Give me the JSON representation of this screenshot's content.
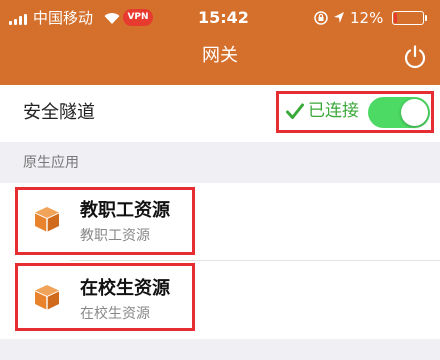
{
  "status_bar": {
    "carrier": "中国移动",
    "vpn_badge": "VPN",
    "time": "15:42",
    "battery_percent": "12%",
    "battery_level": 0.12,
    "icons": [
      "signal-icon",
      "wifi-icon",
      "rotation-lock-icon",
      "location-icon",
      "battery-icon"
    ]
  },
  "nav": {
    "title": "网关",
    "power_icon": "power-icon"
  },
  "tunnel": {
    "label": "安全隧道",
    "status": "已连接",
    "toggle_on": true,
    "check_icon": "checkmark-icon"
  },
  "section": {
    "title": "原生应用"
  },
  "apps": [
    {
      "name": "教职工资源",
      "subtitle": "教职工资源",
      "icon": "box-icon"
    },
    {
      "name": "在校生资源",
      "subtitle": "在校生资源",
      "icon": "box-icon"
    }
  ],
  "colors": {
    "header": "#d46f2c",
    "toggle_on": "#4cd964",
    "connected_text": "#3ba83a",
    "highlight_border": "#e62e32",
    "vpn_badge": "#e63b2e",
    "box_icon": "#e8822d"
  }
}
